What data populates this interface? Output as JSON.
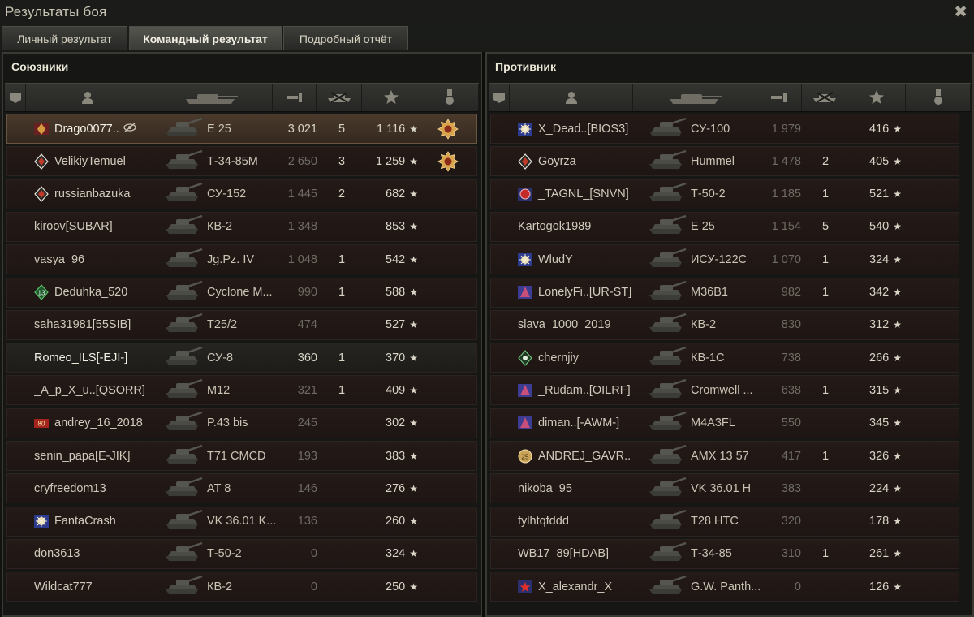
{
  "window": {
    "title": "Результаты боя",
    "close_glyph": "✖"
  },
  "tabs": [
    {
      "label": "Личный результат",
      "active": false
    },
    {
      "label": "Командный результат",
      "active": true
    },
    {
      "label": "Подробный отчёт",
      "active": false
    }
  ],
  "colors": {
    "accent": "#c9a15a",
    "row_bg": "#221917",
    "player_row_bg": "#3e3126"
  },
  "header_icons": [
    "platoon-icon",
    "player-icon",
    "tank-icon",
    "damage-icon",
    "kills-icon",
    "experience-star-icon",
    "medal-icon"
  ],
  "allies": {
    "title": "Союзники",
    "rows": [
      {
        "badge": "clan-crest",
        "name": "Drago0077..",
        "extra_icon": "eye-slash-icon",
        "tank": "Е 25",
        "damage": "3 021",
        "kills": "5",
        "xp": "1 116",
        "medal": true,
        "me": true,
        "dim": false
      },
      {
        "badge": "diamond-badge",
        "name": "VelikiyTemuel",
        "tank": "Т-34-85М",
        "damage": "2 650",
        "kills": "3",
        "xp": "1 259",
        "medal": true,
        "dim": true
      },
      {
        "badge": "diamond-badge",
        "name": "russianbazuka",
        "tank": "СУ-152",
        "damage": "1 445",
        "kills": "2",
        "xp": "682",
        "dim": true
      },
      {
        "badge": "",
        "name": "kiroov[SUBAR]",
        "tank": "КВ-2",
        "damage": "1 348",
        "kills": "",
        "xp": "853",
        "dim": true
      },
      {
        "badge": "",
        "name": "vasya_96",
        "tank": "Jg.Pz. IV",
        "damage": "1 048",
        "kills": "1",
        "xp": "542",
        "dim": true
      },
      {
        "badge": "green-13-badge",
        "name": "Deduhka_520",
        "tank": "Cyclone M...",
        "damage": "990",
        "kills": "1",
        "xp": "588",
        "dim": true
      },
      {
        "badge": "",
        "name": "saha31981[55SIB]",
        "tank": "T25/2",
        "damage": "474",
        "kills": "",
        "xp": "527",
        "dim": true
      },
      {
        "badge": "",
        "name": "Romeo_ILS[-EJI-]",
        "tank": "СУ-8",
        "damage": "360",
        "kills": "1",
        "xp": "370",
        "squad": true,
        "dim": false
      },
      {
        "badge": "",
        "name": "_A_p_X_u..[QSORR]",
        "tank": "M12",
        "damage": "321",
        "kills": "1",
        "xp": "409",
        "dim": true
      },
      {
        "badge": "red-80-badge",
        "name": "andrey_16_2018",
        "tank": "P.43 bis",
        "damage": "245",
        "kills": "",
        "xp": "302",
        "dim": true
      },
      {
        "badge": "",
        "name": "senin_papa[E-JIK]",
        "tank": "T71 CMCD",
        "damage": "193",
        "kills": "",
        "xp": "383",
        "dim": true
      },
      {
        "badge": "",
        "name": "cryfreedom13",
        "tank": "AT 8",
        "damage": "146",
        "kills": "",
        "xp": "276",
        "dim": true
      },
      {
        "badge": "snowflake-badge",
        "name": "FantaCrash",
        "tank": "VK 36.01 K...",
        "damage": "136",
        "kills": "",
        "xp": "260",
        "dim": true
      },
      {
        "badge": "",
        "name": "don3613",
        "tank": "Т-50-2",
        "damage": "0",
        "kills": "",
        "xp": "324",
        "dim": true
      },
      {
        "badge": "",
        "name": "Wildcat777",
        "tank": "КВ-2",
        "damage": "0",
        "kills": "",
        "xp": "250",
        "dim": true
      }
    ]
  },
  "enemies": {
    "title": "Противник",
    "rows": [
      {
        "badge": "snowflake-badge",
        "name": "X_Dead..[BIOS3]",
        "tank": "СУ-100",
        "damage": "1 979",
        "kills": "",
        "xp": "416",
        "dim": true
      },
      {
        "badge": "diamond-badge",
        "name": "Goyrza",
        "tank": "Hummel",
        "damage": "1 478",
        "kills": "2",
        "xp": "405",
        "dim": true
      },
      {
        "badge": "red-circle-badge",
        "name": "_TAGNL_[SNVN]",
        "tank": "Т-50-2",
        "damage": "1 185",
        "kills": "1",
        "xp": "521",
        "dim": true
      },
      {
        "badge": "",
        "name": "Kartogok1989",
        "tank": "E 25",
        "damage": "1 154",
        "kills": "5",
        "xp": "540",
        "dim": true
      },
      {
        "badge": "snowflake-badge",
        "name": "WludY",
        "tank": "ИСУ-122С",
        "damage": "1 070",
        "kills": "1",
        "xp": "324",
        "dim": true
      },
      {
        "badge": "triangle-badge",
        "name": "LonelyFi..[UR-ST]",
        "tank": "M36B1",
        "damage": "982",
        "kills": "1",
        "xp": "342",
        "dim": true
      },
      {
        "badge": "",
        "name": "slava_1000_2019",
        "tank": "КВ-2",
        "damage": "830",
        "kills": "",
        "xp": "312",
        "dim": true
      },
      {
        "badge": "green-star-badge",
        "name": "chernjiy",
        "tank": "КВ-1С",
        "damage": "738",
        "kills": "",
        "xp": "266",
        "dim": true
      },
      {
        "badge": "triangle-badge",
        "name": "_Rudam..[OILRF]",
        "tank": "Cromwell ...",
        "damage": "638",
        "kills": "1",
        "xp": "315",
        "dim": true
      },
      {
        "badge": "triangle-badge",
        "name": "diman..[-AWM-]",
        "tank": "M4A3FL",
        "damage": "550",
        "kills": "",
        "xp": "345",
        "dim": true
      },
      {
        "badge": "gold-25-badge",
        "name": "ANDREJ_GAVR..",
        "tank": "AMX 13 57",
        "damage": "417",
        "kills": "1",
        "xp": "326",
        "dim": true
      },
      {
        "badge": "",
        "name": "nikoba_95",
        "tank": "VK 36.01 H",
        "damage": "383",
        "kills": "",
        "xp": "224",
        "dim": true
      },
      {
        "badge": "",
        "name": "fylhtqfddd",
        "tank": "T28 HTC",
        "damage": "320",
        "kills": "",
        "xp": "178",
        "dim": true
      },
      {
        "badge": "",
        "name": "WB17_89[HDAB]",
        "tank": "Т-34-85",
        "damage": "310",
        "kills": "1",
        "xp": "261",
        "dim": true
      },
      {
        "badge": "red-star-badge",
        "name": "X_alexandr_X",
        "tank": "G.W. Panth...",
        "damage": "0",
        "kills": "",
        "xp": "126",
        "dim": true
      }
    ]
  }
}
